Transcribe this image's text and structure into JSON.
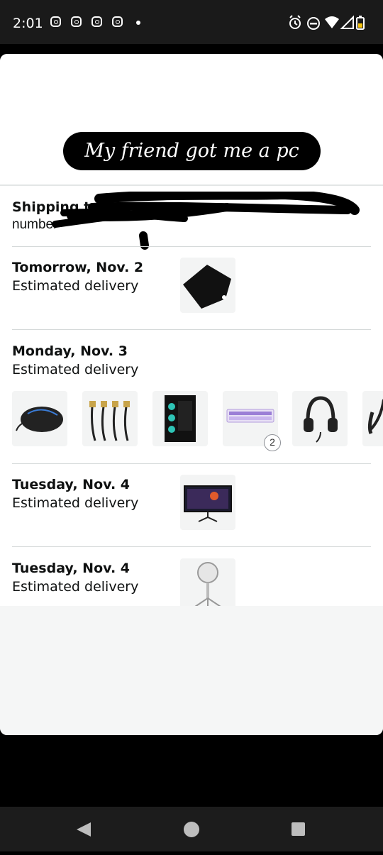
{
  "status_bar": {
    "time": "2:01"
  },
  "story": {
    "caption": "My friend got me a pc"
  },
  "shipping": {
    "label": "Shipping to",
    "address_partial": "number"
  },
  "deliveries": [
    {
      "date": "Tomorrow, Nov. 2",
      "label": "Estimated delivery",
      "items": [
        "mouse pad"
      ]
    },
    {
      "date": "Monday, Nov. 3",
      "label": "Estimated delivery",
      "items": [
        "gaming mouse",
        "HDMI cables",
        "PC case",
        "keyboard",
        "headphones",
        "controller"
      ],
      "keyboard_qty": "2"
    },
    {
      "date": "Tuesday, Nov. 4",
      "label": "Estimated delivery",
      "items": [
        "monitor"
      ]
    },
    {
      "date": "Tuesday, Nov. 4",
      "label": "Estimated delivery",
      "items": [
        "microphone"
      ]
    }
  ],
  "icons": [
    "instagram-icon",
    "alarm-icon",
    "dnd-icon",
    "wifi-icon",
    "signal-icon",
    "battery-icon",
    "back-icon",
    "home-icon",
    "recents-icon"
  ]
}
